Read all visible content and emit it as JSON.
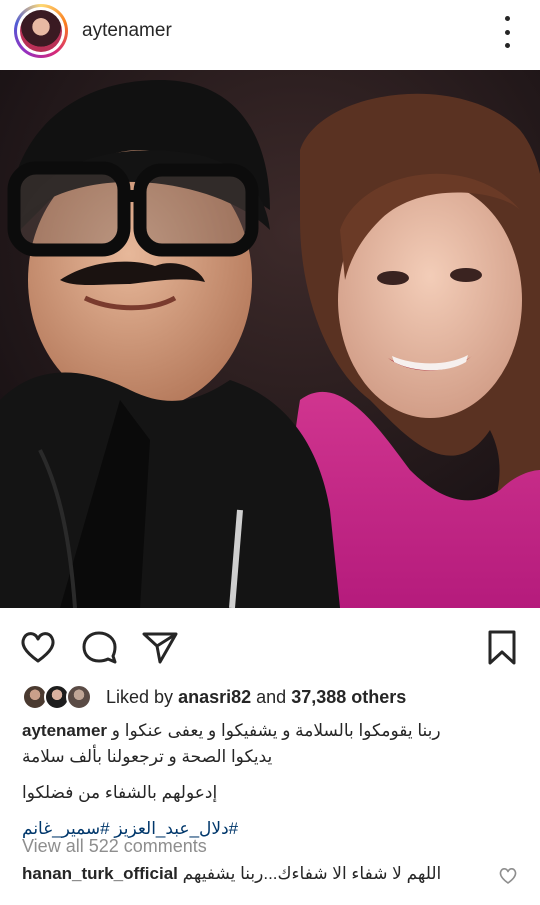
{
  "post": {
    "username": "aytenamer",
    "liked_by_prefix": "Liked by",
    "liked_by_user": "anasri82",
    "liked_by_and": "and",
    "liked_by_others": "37,388 others",
    "caption_user": "aytenamer",
    "caption_line1": "ربنا يقومكوا بالسلامة و يشفيكوا و يعفى عنكوا و",
    "caption_line2": "يديكوا الصحة و ترجعولنا بألف سلامة",
    "caption_line3": "إدعولهم بالشفاء من فضلكوا",
    "hashtags": "#دلال_عبد_العزيز #سمير_غانم",
    "view_all_comments": "View all 522 comments",
    "comment": {
      "user": "hanan_turk_official",
      "text": "اللهم لا شفاء الا شفاءك...ربنا يشفيهم"
    }
  },
  "icons": {
    "more": "more-vertical-icon",
    "like": "heart-icon",
    "comment": "comment-icon",
    "share": "paper-plane-icon",
    "save": "bookmark-icon"
  },
  "colors": {
    "text": "#262626",
    "muted": "#8e8e8e",
    "hashtag": "#00376b"
  }
}
